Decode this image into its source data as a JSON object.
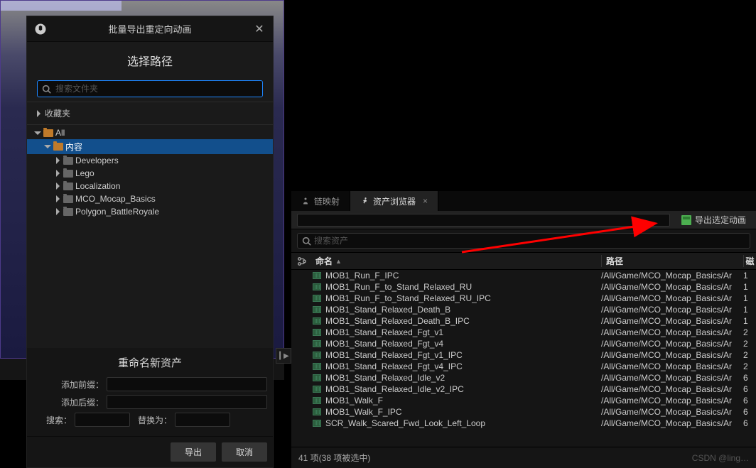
{
  "dialog": {
    "title": "批量导出重定向动画",
    "subtitle": "选择路径",
    "search_placeholder": "搜索文件夹",
    "favorites_label": "收藏夹",
    "tree": [
      {
        "label": "All",
        "depth": 0,
        "expanded": true,
        "open": true
      },
      {
        "label": "内容",
        "depth": 1,
        "expanded": true,
        "open": true,
        "selected": true
      },
      {
        "label": "Developers",
        "depth": 2,
        "expanded": false
      },
      {
        "label": "Lego",
        "depth": 2,
        "expanded": false
      },
      {
        "label": "Localization",
        "depth": 2,
        "expanded": false
      },
      {
        "label": "MCO_Mocap_Basics",
        "depth": 2,
        "expanded": false
      },
      {
        "label": "Polygon_BattleRoyale",
        "depth": 2,
        "expanded": false
      }
    ],
    "rename": {
      "title": "重命名新资产",
      "prefix_label": "添加前缀：",
      "suffix_label": "添加后缀：",
      "search_label": "搜索：",
      "replace_label": "替换为："
    },
    "buttons": {
      "export": "导出",
      "cancel": "取消"
    }
  },
  "right": {
    "tabs": {
      "chain": "链映射",
      "browser": "资产浏览器"
    },
    "export_selected": "导出选定动画",
    "search_placeholder": "搜索资产",
    "columns": {
      "name": "命名",
      "path": "路径",
      "ext": "磁"
    },
    "assets": [
      {
        "name": "MOB1_Run_F_IPC",
        "path": "/All/Game/MCO_Mocap_Basics/Ar",
        "ext": "1"
      },
      {
        "name": "MOB1_Run_F_to_Stand_Relaxed_RU",
        "path": "/All/Game/MCO_Mocap_Basics/Ar",
        "ext": "1"
      },
      {
        "name": "MOB1_Run_F_to_Stand_Relaxed_RU_IPC",
        "path": "/All/Game/MCO_Mocap_Basics/Ar",
        "ext": "1"
      },
      {
        "name": "MOB1_Stand_Relaxed_Death_B",
        "path": "/All/Game/MCO_Mocap_Basics/Ar",
        "ext": "1"
      },
      {
        "name": "MOB1_Stand_Relaxed_Death_B_IPC",
        "path": "/All/Game/MCO_Mocap_Basics/Ar",
        "ext": "1"
      },
      {
        "name": "MOB1_Stand_Relaxed_Fgt_v1",
        "path": "/All/Game/MCO_Mocap_Basics/Ar",
        "ext": "2"
      },
      {
        "name": "MOB1_Stand_Relaxed_Fgt_v4",
        "path": "/All/Game/MCO_Mocap_Basics/Ar",
        "ext": "2"
      },
      {
        "name": "MOB1_Stand_Relaxed_Fgt_v1_IPC",
        "path": "/All/Game/MCO_Mocap_Basics/Ar",
        "ext": "2"
      },
      {
        "name": "MOB1_Stand_Relaxed_Fgt_v4_IPC",
        "path": "/All/Game/MCO_Mocap_Basics/Ar",
        "ext": "2"
      },
      {
        "name": "MOB1_Stand_Relaxed_Idle_v2",
        "path": "/All/Game/MCO_Mocap_Basics/Ar",
        "ext": "6"
      },
      {
        "name": "MOB1_Stand_Relaxed_Idle_v2_IPC",
        "path": "/All/Game/MCO_Mocap_Basics/Ar",
        "ext": "6"
      },
      {
        "name": "MOB1_Walk_F",
        "path": "/All/Game/MCO_Mocap_Basics/Ar",
        "ext": "6"
      },
      {
        "name": "MOB1_Walk_F_IPC",
        "path": "/All/Game/MCO_Mocap_Basics/Ar",
        "ext": "6"
      },
      {
        "name": "SCR_Walk_Scared_Fwd_Look_Left_Loop",
        "path": "/All/Game/MCO_Mocap_Basics/Ar",
        "ext": "6"
      }
    ],
    "footer": "41 项(38 项被选中)",
    "watermark": "CSDN @ling…"
  }
}
